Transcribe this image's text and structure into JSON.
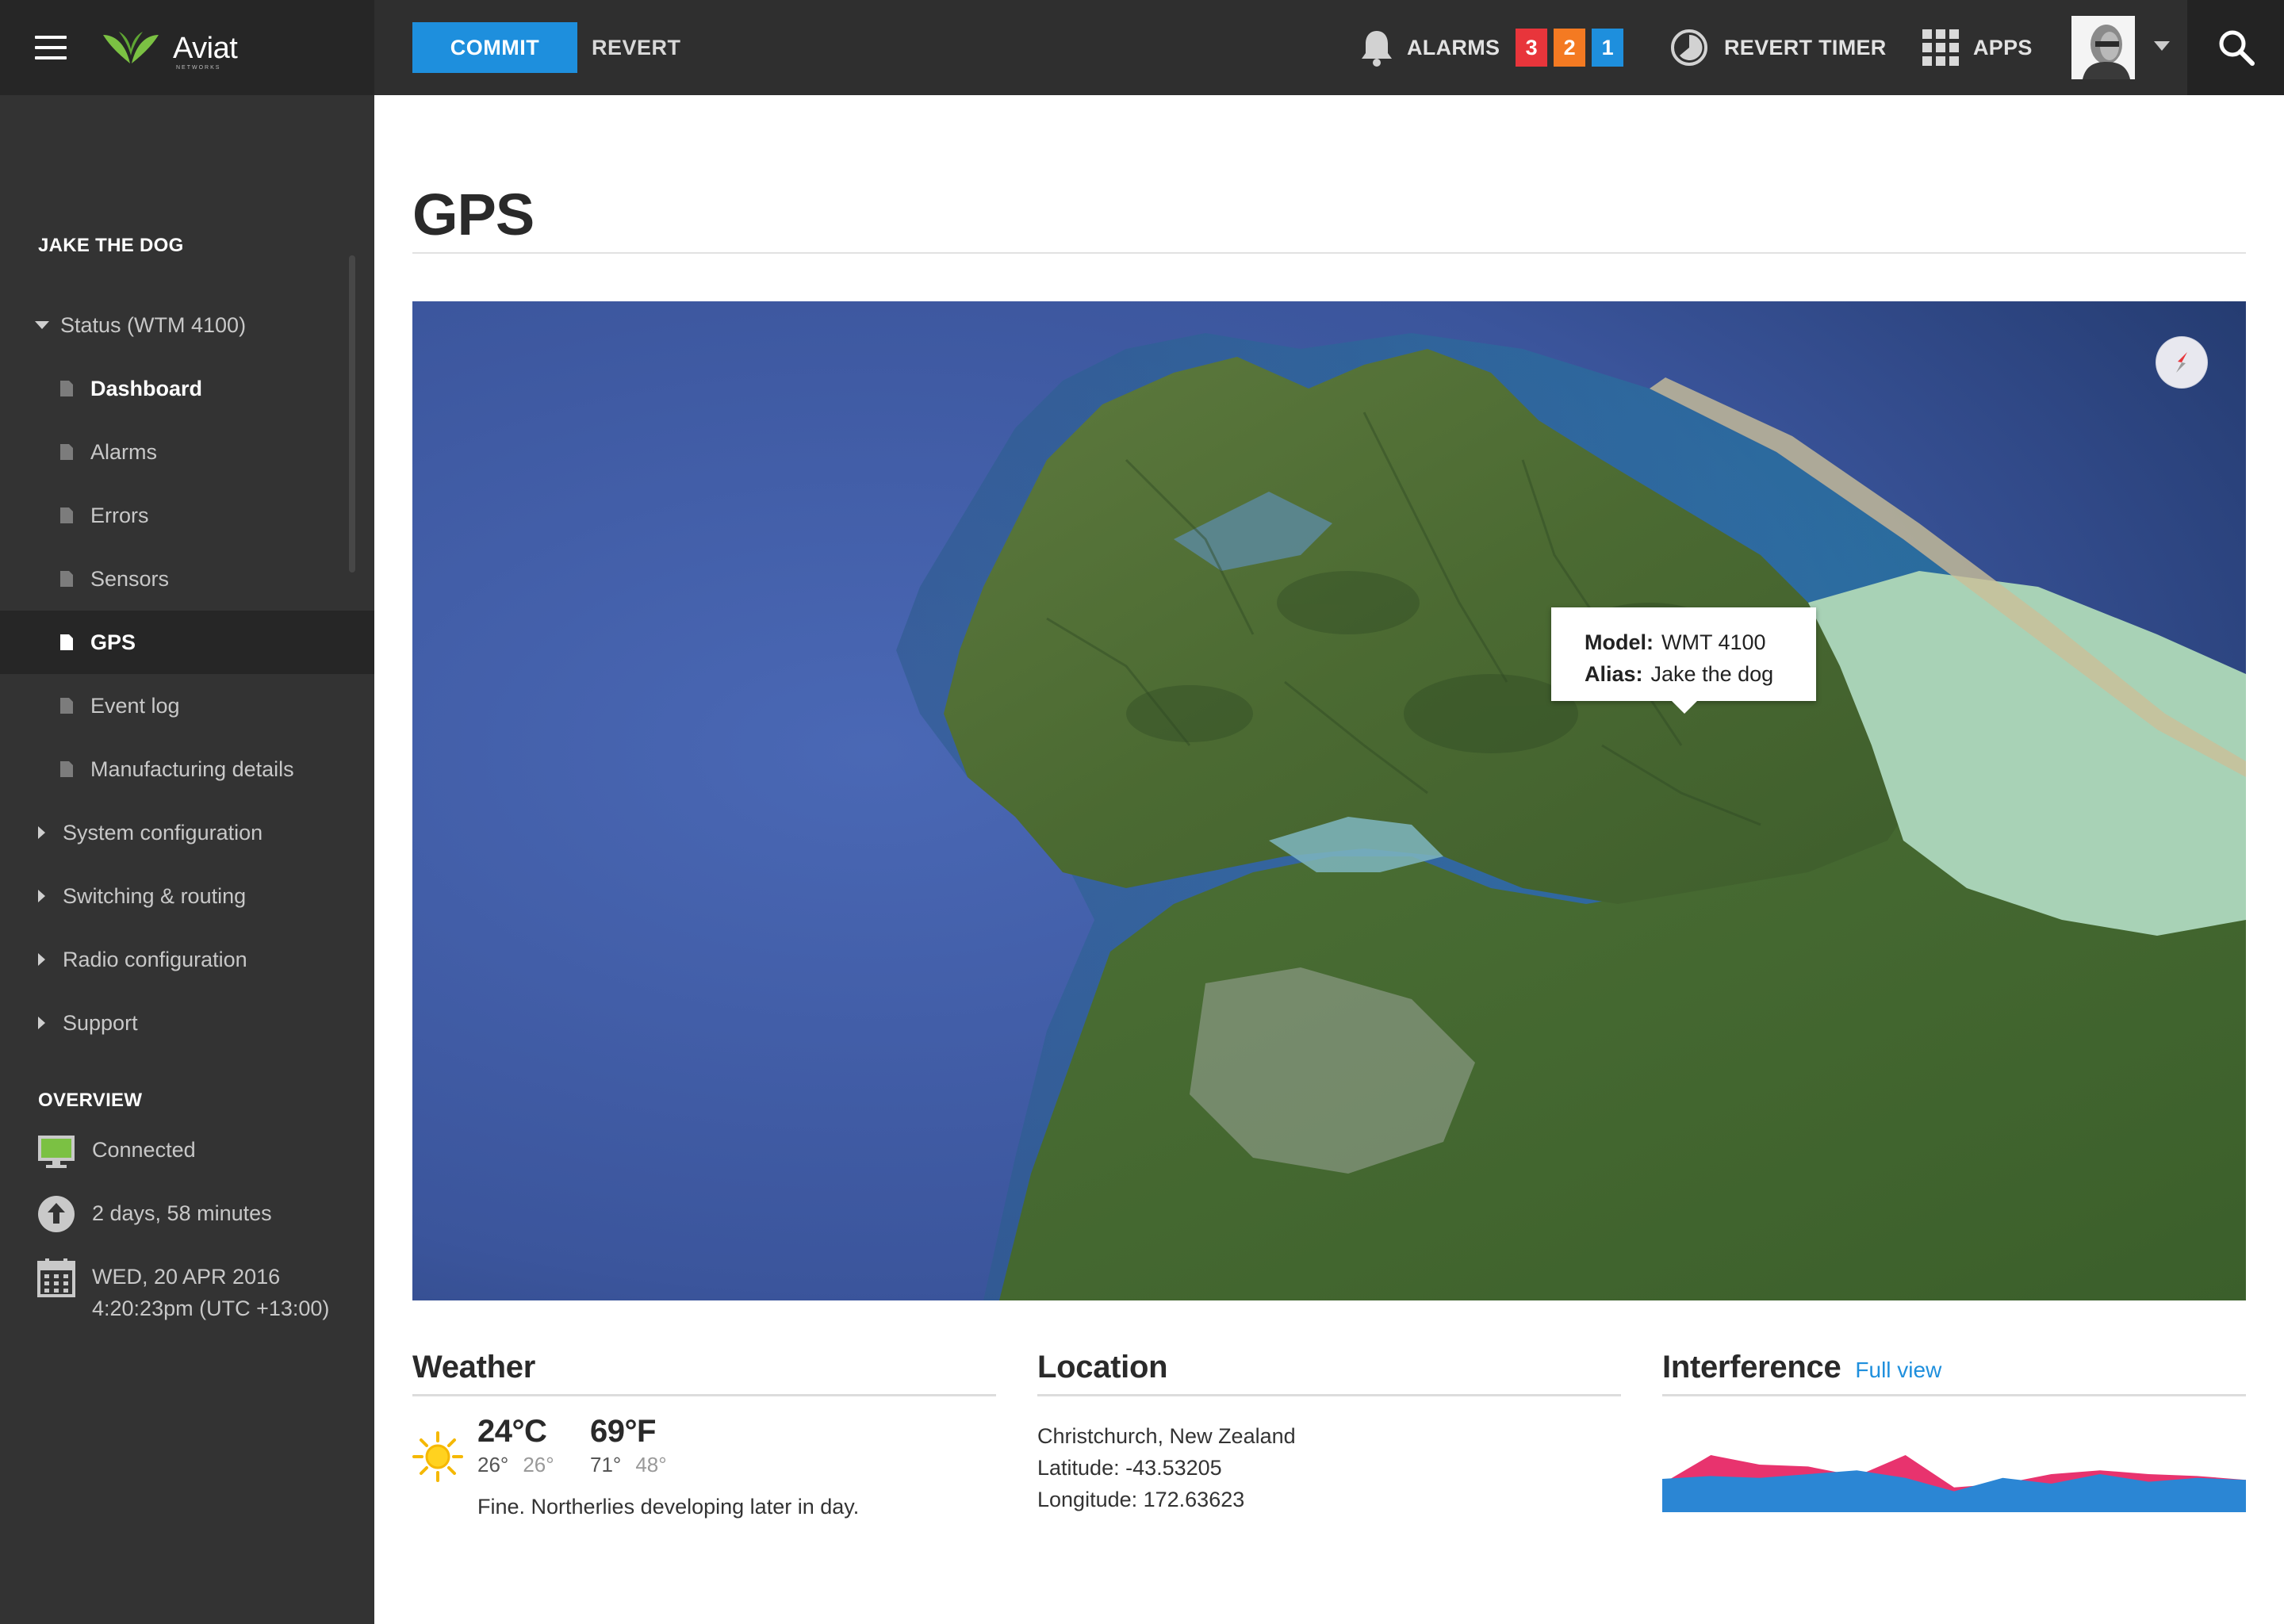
{
  "brand": {
    "name": "Aviat",
    "sub": "NETWORKS"
  },
  "toolbar": {
    "commit_label": "COMMIT",
    "revert_label": "REVERT",
    "alarms_label": "ALARMS",
    "alarm_counts": {
      "critical": "3",
      "major": "2",
      "minor": "1"
    },
    "revert_timer_label": "REVERT TIMER",
    "apps_label": "APPS"
  },
  "colors": {
    "accent": "#1e8fdd",
    "critical": "#e8353b",
    "major": "#f47a22",
    "sidebar_bg": "#333333",
    "topbar_bg": "#2f2f2f",
    "interference_pink": "#e8336e",
    "interference_blue": "#2b86d4"
  },
  "sidebar": {
    "device_heading": "JAKE THE DOG",
    "status_group": "Status (WTM 4100)",
    "status_items": [
      "Dashboard",
      "Alarms",
      "Errors",
      "Sensors",
      "GPS",
      "Event log",
      "Manufacturing details"
    ],
    "active_item": "GPS",
    "groups": [
      "System configuration",
      "Switching & routing",
      "Radio configuration",
      "Support"
    ],
    "overview_heading": "OVERVIEW",
    "overview": {
      "connection": "Connected",
      "uptime": "2 days, 58 minutes",
      "date": "WED, 20 APR 2016",
      "time": "4:20:23pm (UTC +13:00)"
    }
  },
  "page": {
    "title": "GPS"
  },
  "map": {
    "tooltip": {
      "model_label": "Model:",
      "model_value": "WMT 4100",
      "alias_label": "Alias:",
      "alias_value": "Jake the dog"
    }
  },
  "weather": {
    "title": "Weather",
    "celsius": "24°C",
    "celsius_high": "26°",
    "celsius_low": "26°",
    "fahrenheit": "69°F",
    "fahrenheit_high": "71°",
    "fahrenheit_low": "48°",
    "forecast": "Fine. Northerlies developing later in day."
  },
  "location": {
    "title": "Location",
    "place": "Christchurch, New Zealand",
    "latitude": "Latitude: -43.53205",
    "longitude": "Longitude: 172.63623"
  },
  "interference": {
    "title": "Interference",
    "link_label": "Full view"
  },
  "chart_data": {
    "type": "area",
    "title": "",
    "xlabel": "",
    "ylabel": "",
    "ylim": [
      0,
      1
    ],
    "x": [
      0,
      1,
      2,
      3,
      4,
      5,
      6,
      7,
      8,
      9,
      10,
      11,
      12
    ],
    "series": [
      {
        "values": [
          0.35,
          0.38,
          0.36,
          0.4,
          0.44,
          0.36,
          0.22,
          0.36,
          0.3,
          0.4,
          0.32,
          0.36,
          0.34
        ]
      },
      {
        "values": [
          0.3,
          0.6,
          0.5,
          0.48,
          0.38,
          0.6,
          0.26,
          0.3,
          0.4,
          0.44,
          0.4,
          0.38,
          0.34
        ]
      }
    ]
  }
}
